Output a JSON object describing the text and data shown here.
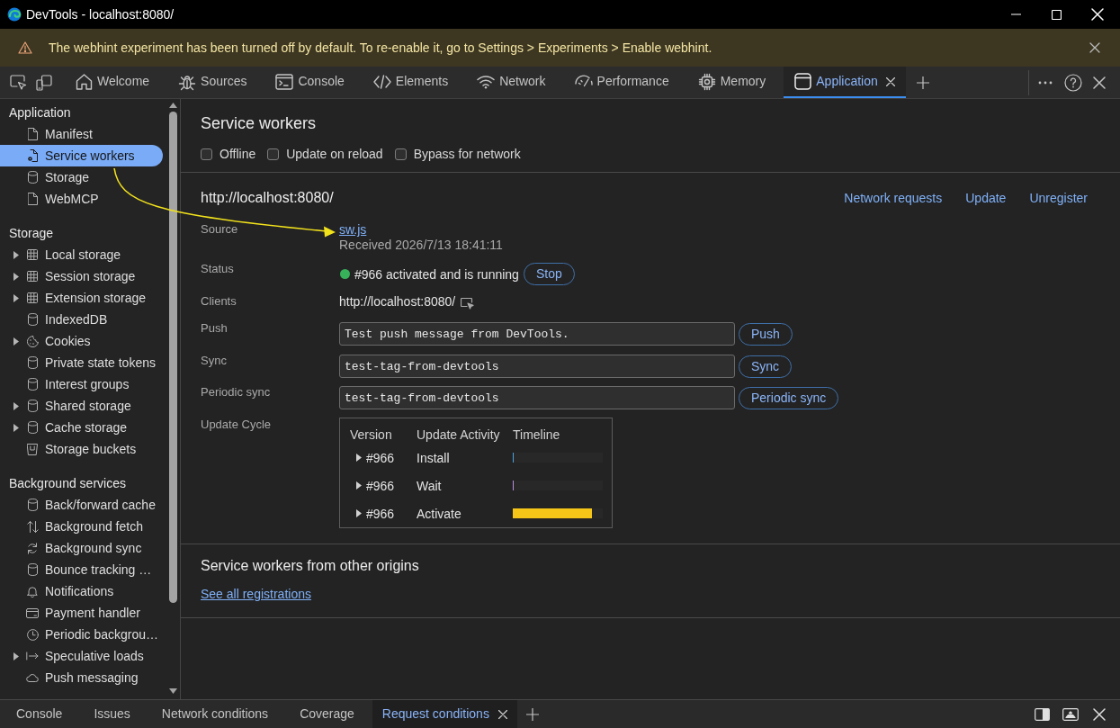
{
  "window": {
    "title": "DevTools - localhost:8080/"
  },
  "infobar": {
    "message": "The webhint experiment has been turned off by default. To re-enable it, go to Settings > Experiments > Enable webhint."
  },
  "tabs": [
    {
      "label": "Welcome",
      "selected": false
    },
    {
      "label": "Sources",
      "selected": false
    },
    {
      "label": "Console",
      "selected": false
    },
    {
      "label": "Elements",
      "selected": false
    },
    {
      "label": "Network",
      "selected": false
    },
    {
      "label": "Performance",
      "selected": false
    },
    {
      "label": "Memory",
      "selected": false
    },
    {
      "label": "Application",
      "selected": true
    }
  ],
  "sidebar": {
    "sections": [
      {
        "title": "Application",
        "items": [
          {
            "label": "Manifest",
            "selected": false
          },
          {
            "label": "Service workers",
            "selected": true
          },
          {
            "label": "Storage",
            "selected": false
          },
          {
            "label": "WebMCP",
            "selected": false
          }
        ]
      },
      {
        "title": "Storage",
        "items": [
          {
            "label": "Local storage",
            "selected": false,
            "expanded": false
          },
          {
            "label": "Session storage",
            "selected": false,
            "expanded": false
          },
          {
            "label": "Extension storage",
            "selected": false,
            "expanded": false
          },
          {
            "label": "IndexedDB",
            "selected": false
          },
          {
            "label": "Cookies",
            "selected": false,
            "expanded": false
          },
          {
            "label": "Private state tokens",
            "selected": false
          },
          {
            "label": "Interest groups",
            "selected": false
          },
          {
            "label": "Shared storage",
            "selected": false,
            "expanded": false
          },
          {
            "label": "Cache storage",
            "selected": false,
            "expanded": false
          },
          {
            "label": "Storage buckets",
            "selected": false
          }
        ]
      },
      {
        "title": "Background services",
        "items": [
          {
            "label": "Back/forward cache",
            "selected": false
          },
          {
            "label": "Background fetch",
            "selected": false
          },
          {
            "label": "Background sync",
            "selected": false
          },
          {
            "label": "Bounce tracking …",
            "selected": false
          },
          {
            "label": "Notifications",
            "selected": false
          },
          {
            "label": "Payment handler",
            "selected": false
          },
          {
            "label": "Periodic backgrou…",
            "selected": false
          },
          {
            "label": "Speculative loads",
            "selected": false,
            "expanded": false
          },
          {
            "label": "Push messaging",
            "selected": false
          }
        ]
      }
    ]
  },
  "panel": {
    "title": "Service workers",
    "options": [
      {
        "label": "Offline",
        "checked": false
      },
      {
        "label": "Update on reload",
        "checked": false
      },
      {
        "label": "Bypass for network",
        "checked": false
      }
    ],
    "registration": {
      "origin": "http://localhost:8080/",
      "actions": [
        "Network requests",
        "Update",
        "Unregister"
      ],
      "source": {
        "label": "Source",
        "file": "sw.js",
        "received": "Received 2026/7/13 18:41:11"
      },
      "status": {
        "label": "Status",
        "text": "#966 activated and is running",
        "color": "#37b25a",
        "button": "Stop"
      },
      "clients": {
        "label": "Clients",
        "value": "http://localhost:8080/"
      },
      "push": {
        "label": "Push",
        "value": "Test push message from DevTools.",
        "button": "Push"
      },
      "sync": {
        "label": "Sync",
        "value": "test-tag-from-devtools",
        "button": "Sync"
      },
      "periodic_sync": {
        "label": "Periodic sync",
        "value": "test-tag-from-devtools",
        "button": "Periodic sync"
      },
      "update_cycle": {
        "label": "Update Cycle",
        "columns": [
          "Version",
          "Update Activity",
          "Timeline"
        ],
        "rows": [
          {
            "version": "#966",
            "expanded": false,
            "activity": "Install",
            "color": "#4aa3df",
            "level": 0.01
          },
          {
            "version": "#966",
            "expanded": false,
            "activity": "Wait",
            "color": "#b68fe0",
            "level": 0.01
          },
          {
            "version": "#966",
            "expanded": false,
            "activity": "Activate",
            "color": "#f5c518",
            "level": 0.88
          }
        ]
      }
    },
    "other_origins": {
      "title": "Service workers from other origins",
      "link": "See all registrations"
    }
  },
  "drawer": {
    "tabs": [
      {
        "label": "Console",
        "selected": false
      },
      {
        "label": "Issues",
        "selected": false
      },
      {
        "label": "Network conditions",
        "selected": false
      },
      {
        "label": "Coverage",
        "selected": false
      },
      {
        "label": "Request conditions",
        "selected": true
      }
    ]
  }
}
